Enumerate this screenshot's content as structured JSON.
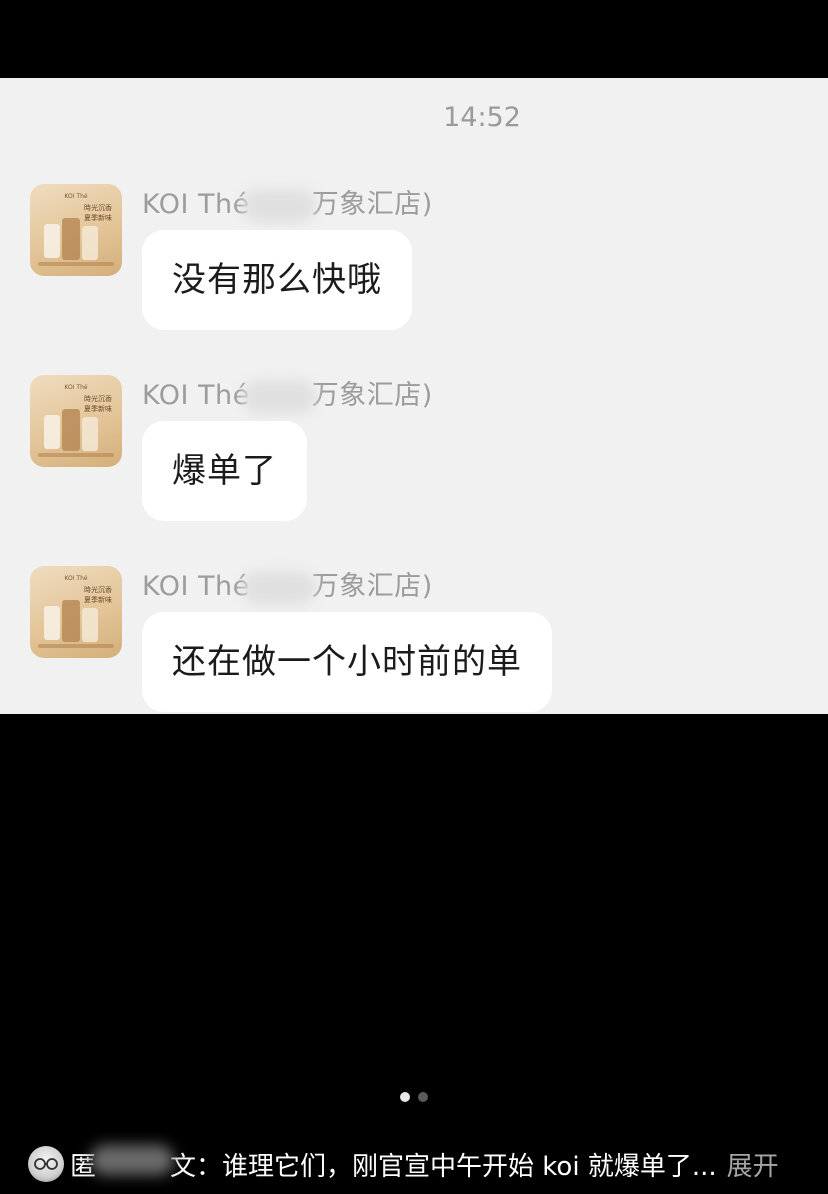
{
  "chat": {
    "timestamp": "14:52",
    "messages": [
      {
        "sender_prefix": "KOI Thé",
        "sender_suffix": "万象汇店)",
        "text": "没有那么快哦"
      },
      {
        "sender_prefix": "KOI Thé",
        "sender_suffix": "万象汇店)",
        "text": "爆单了"
      },
      {
        "sender_prefix": "KOI Thé",
        "sender_suffix": "万象汇店)",
        "text": "还在做一个小时前的单"
      }
    ]
  },
  "carousel": {
    "total": 2,
    "active": 1
  },
  "caption": {
    "name_visible": "匿",
    "name_tail": "文",
    "text": "：谁理它们，刚官宣中午开始 koi 就爆单了...",
    "expand_label": "展开"
  },
  "colors": {
    "chat_background": "#f1f1f1",
    "bubble": "#ffffff",
    "muted_text": "#9c9c9c",
    "screen_background": "#000000"
  }
}
